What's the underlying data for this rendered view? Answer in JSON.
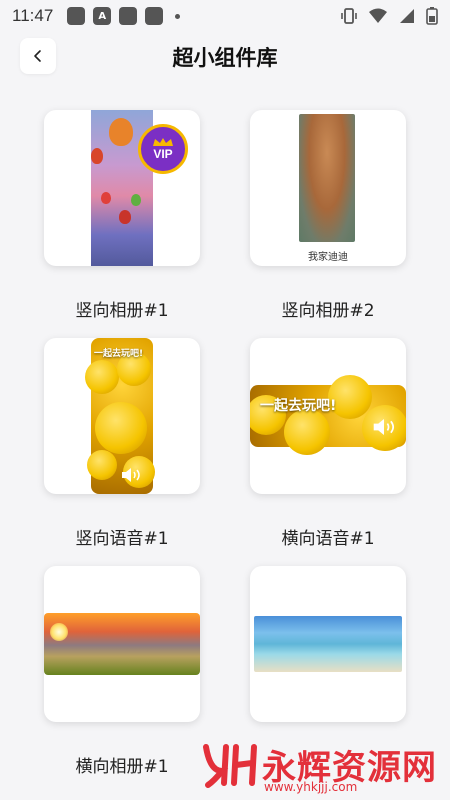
{
  "status_bar": {
    "time": "11:47",
    "icons": [
      "app-icon",
      "a-icon",
      "app-icon",
      "app-icon"
    ],
    "a_letter": "A"
  },
  "header": {
    "back_icon": "chevron-left-icon",
    "title": "超小组件库"
  },
  "widgets": [
    {
      "label": "竖向相册#1",
      "preview": "vertical-album",
      "badge": "VIP"
    },
    {
      "label": "竖向相册#2",
      "preview": "vertical-album",
      "caption": "我家迪迪"
    },
    {
      "label": "竖向语音#1",
      "preview": "vertical-voice",
      "voice_text": "一起去玩吧!"
    },
    {
      "label": "横向语音#1",
      "preview": "horizontal-voice",
      "voice_text": "一起去玩吧!"
    },
    {
      "label": "横向相册#1",
      "preview": "horizontal-album"
    },
    {
      "label": "",
      "preview": "horizontal-album"
    }
  ],
  "watermark": {
    "text": "永辉资源网",
    "url": "www.yhkjjj.com"
  },
  "colors": {
    "background": "#f5f5f7",
    "card": "#ffffff",
    "watermark": "#e3303a",
    "vip_purple": "#7b2fc4",
    "vip_gold": "#f6b800"
  }
}
